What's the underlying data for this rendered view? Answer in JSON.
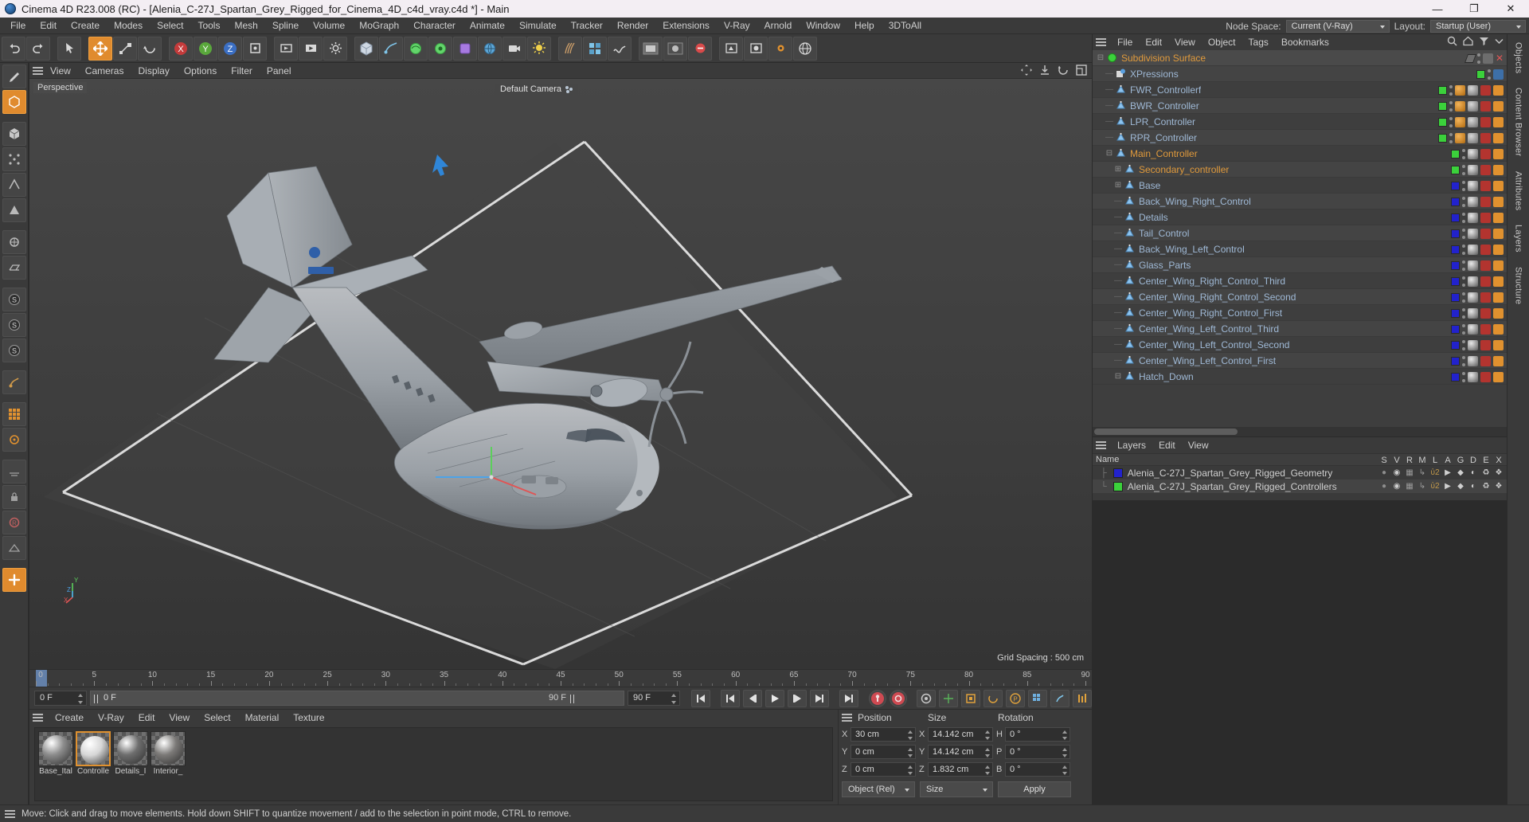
{
  "window": {
    "title": "Cinema 4D R23.008 (RC) - [Alenia_C-27J_Spartan_Grey_Rigged_for_Cinema_4D_c4d_vray.c4d *] - Main",
    "minimize": "—",
    "maximize": "❐",
    "close": "✕"
  },
  "menu": {
    "items": [
      "File",
      "Edit",
      "Create",
      "Modes",
      "Select",
      "Tools",
      "Mesh",
      "Spline",
      "Volume",
      "MoGraph",
      "Character",
      "Animate",
      "Simulate",
      "Tracker",
      "Render",
      "Extensions",
      "V-Ray",
      "Arnold",
      "Window",
      "Help",
      "3DToAll"
    ]
  },
  "topright": {
    "node_space_label": "Node Space:",
    "node_space_value": "Current (V-Ray)",
    "layout_label": "Layout:",
    "layout_value": "Startup (User)"
  },
  "viewport": {
    "menu": [
      "View",
      "Cameras",
      "Display",
      "Options",
      "Filter",
      "Panel"
    ],
    "perspective_label": "Perspective",
    "camera_label": "Default Camera",
    "grid_spacing": "Grid Spacing : 500 cm",
    "axis_x": "X",
    "axis_y": "Y",
    "axis_z": "Z"
  },
  "timeline": {
    "labels": [
      "0",
      "5",
      "10",
      "15",
      "20",
      "25",
      "30",
      "35",
      "40",
      "45",
      "50",
      "55",
      "60",
      "65",
      "70",
      "75",
      "80",
      "85",
      "90"
    ],
    "values": [
      0,
      5,
      10,
      15,
      20,
      25,
      30,
      35,
      40,
      45,
      50,
      55,
      60,
      65,
      70,
      75,
      80,
      85,
      90
    ],
    "min": 0,
    "max": 90,
    "current_frame": "0 F",
    "current_frame_right": "0 F",
    "range_start": "0 F",
    "preview_bar_label": "0 F",
    "range_end": "90 F",
    "doc_end": "90 F"
  },
  "materials": {
    "menu": [
      "Create",
      "V-Ray",
      "Edit",
      "View",
      "Select",
      "Material",
      "Texture"
    ],
    "items": [
      {
        "name": "Base_Ital",
        "selected": false,
        "color": "#8d8d8d"
      },
      {
        "name": "Controlle",
        "selected": true,
        "color": "#d6d6d6"
      },
      {
        "name": "Details_I",
        "selected": false,
        "color": "#6e6e6e"
      },
      {
        "name": "Interior_",
        "selected": false,
        "color": "#7c7a78"
      }
    ]
  },
  "coordinates": {
    "headers": [
      "Position",
      "Size",
      "Rotation"
    ],
    "rows": [
      {
        "axis_pos": "X",
        "pos": "30 cm",
        "axis_size": "X",
        "size": "14.142 cm",
        "axis_rot": "H",
        "rot": "0 °"
      },
      {
        "axis_pos": "Y",
        "pos": "0 cm",
        "axis_size": "Y",
        "size": "14.142 cm",
        "axis_rot": "P",
        "rot": "0 °"
      },
      {
        "axis_pos": "Z",
        "pos": "0 cm",
        "axis_size": "Z",
        "size": "1.832 cm",
        "axis_rot": "B",
        "rot": "0 °"
      }
    ],
    "mode_select": "Object (Rel)",
    "size_select": "Size",
    "apply_button": "Apply"
  },
  "object_manager": {
    "menu": [
      "File",
      "Edit",
      "View",
      "Object",
      "Tags",
      "Bookmarks"
    ],
    "items": [
      {
        "name": "Subdivision Surface",
        "depth": 0,
        "color": "#e09a3c",
        "swatch": "none",
        "expander": "minus",
        "icon": "subdivision-surface-icon",
        "selected": true,
        "tags": "close"
      },
      {
        "name": "XPressions",
        "depth": 1,
        "color": "#9fb9d6",
        "swatch": "#3bd13b",
        "expander": "",
        "icon": "xpresso-icon",
        "tags": "xpresso"
      },
      {
        "name": "FWR_Controllerf",
        "depth": 1,
        "color": "#9fb9d6",
        "swatch": "#3bd13b",
        "expander": "",
        "icon": "null-icon",
        "tags": "protect"
      },
      {
        "name": "BWR_Controller",
        "depth": 1,
        "color": "#9fb9d6",
        "swatch": "#3bd13b",
        "expander": "",
        "icon": "null-icon",
        "tags": "protect"
      },
      {
        "name": "LPR_Controller",
        "depth": 1,
        "color": "#9fb9d6",
        "swatch": "#3bd13b",
        "expander": "",
        "icon": "null-icon",
        "tags": "protect"
      },
      {
        "name": "RPR_Controller",
        "depth": 1,
        "color": "#9fb9d6",
        "swatch": "#3bd13b",
        "expander": "",
        "icon": "null-icon",
        "tags": "protect"
      },
      {
        "name": "Main_Controller",
        "depth": 1,
        "color": "#e09a3c",
        "swatch": "#3bd13b",
        "expander": "minus",
        "icon": "null-icon",
        "tags": "material"
      },
      {
        "name": "Secondary_controller",
        "depth": 2,
        "color": "#e09a3c",
        "swatch": "#3bd13b",
        "expander": "plus",
        "icon": "null-icon",
        "tags": "material"
      },
      {
        "name": "Base",
        "depth": 2,
        "color": "#9fb9d6",
        "swatch": "#2222cc",
        "expander": "plus",
        "icon": "null-icon",
        "tags": "material"
      },
      {
        "name": "Back_Wing_Right_Control",
        "depth": 2,
        "color": "#9fb9d6",
        "swatch": "#2222cc",
        "expander": "",
        "icon": "null-icon",
        "tags": "material"
      },
      {
        "name": "Details",
        "depth": 2,
        "color": "#9fb9d6",
        "swatch": "#2222cc",
        "expander": "",
        "icon": "null-icon",
        "tags": "material"
      },
      {
        "name": "Tail_Control",
        "depth": 2,
        "color": "#9fb9d6",
        "swatch": "#2222cc",
        "expander": "",
        "icon": "null-icon",
        "tags": "material"
      },
      {
        "name": "Back_Wing_Left_Control",
        "depth": 2,
        "color": "#9fb9d6",
        "swatch": "#2222cc",
        "expander": "",
        "icon": "null-icon",
        "tags": "material"
      },
      {
        "name": "Glass_Parts",
        "depth": 2,
        "color": "#9fb9d6",
        "swatch": "#2222cc",
        "expander": "",
        "icon": "null-icon",
        "tags": "material"
      },
      {
        "name": "Center_Wing_Right_Control_Third",
        "depth": 2,
        "color": "#9fb9d6",
        "swatch": "#2222cc",
        "expander": "",
        "icon": "null-icon",
        "tags": "material"
      },
      {
        "name": "Center_Wing_Right_Control_Second",
        "depth": 2,
        "color": "#9fb9d6",
        "swatch": "#2222cc",
        "expander": "",
        "icon": "null-icon",
        "tags": "material"
      },
      {
        "name": "Center_Wing_Right_Control_First",
        "depth": 2,
        "color": "#9fb9d6",
        "swatch": "#2222cc",
        "expander": "",
        "icon": "null-icon",
        "tags": "material"
      },
      {
        "name": "Center_Wing_Left_Control_Third",
        "depth": 2,
        "color": "#9fb9d6",
        "swatch": "#2222cc",
        "expander": "",
        "icon": "null-icon",
        "tags": "material"
      },
      {
        "name": "Center_Wing_Left_Control_Second",
        "depth": 2,
        "color": "#9fb9d6",
        "swatch": "#2222cc",
        "expander": "",
        "icon": "null-icon",
        "tags": "material"
      },
      {
        "name": "Center_Wing_Left_Control_First",
        "depth": 2,
        "color": "#9fb9d6",
        "swatch": "#2222cc",
        "expander": "",
        "icon": "null-icon",
        "tags": "material"
      },
      {
        "name": "Hatch_Down",
        "depth": 2,
        "color": "#9fb9d6",
        "swatch": "#2222cc",
        "expander": "minus",
        "icon": "null-icon",
        "tags": "material"
      }
    ]
  },
  "layers": {
    "menu": [
      "Layers",
      "Edit",
      "View"
    ],
    "name_header": "Name",
    "columns": [
      "S",
      "V",
      "R",
      "M",
      "L",
      "A",
      "G",
      "D",
      "E",
      "X"
    ],
    "rows": [
      {
        "name": "Alenia_C-27J_Spartan_Grey_Rigged_Geometry",
        "color": "#2222cc"
      },
      {
        "name": "Alenia_C-27J_Spartan_Grey_Rigged_Controllers",
        "color": "#3bd13b"
      }
    ]
  },
  "right_tabs": [
    "Objects",
    "Content Browser",
    "Attributes",
    "Layers",
    "Structure"
  ],
  "statusbar": {
    "text": "Move: Click and drag to move elements. Hold down SHIFT to quantize movement / add to the selection in point mode, CTRL to remove."
  },
  "colors": {
    "accent_orange": "#e09a3c",
    "selection_blue": "#6b8dbd",
    "panel_bg": "#3a3a3a",
    "list_bg": "#3e3e3e",
    "green_layer": "#3bd13b",
    "blue_layer": "#2222cc"
  }
}
